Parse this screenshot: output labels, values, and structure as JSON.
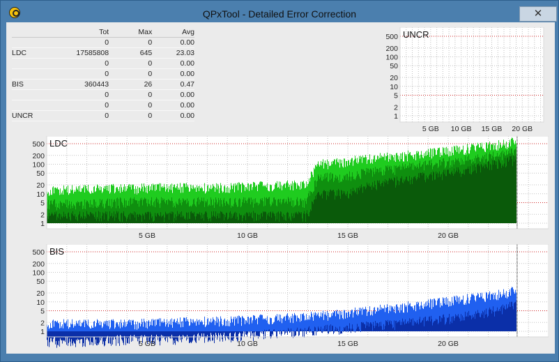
{
  "window": {
    "title": "QPxTool - Detailed Error Correction",
    "close_label": "✕"
  },
  "table": {
    "columns": [
      "",
      "Tot",
      "Max",
      "Avg"
    ],
    "rows": [
      [
        "",
        "0",
        "0",
        "0.00"
      ],
      [
        "LDC",
        "17585808",
        "645",
        "23.03"
      ],
      [
        "",
        "0",
        "0",
        "0.00"
      ],
      [
        "",
        "0",
        "0",
        "0.00"
      ],
      [
        "BIS",
        "360443",
        "26",
        "0.47"
      ],
      [
        "",
        "0",
        "0",
        "0.00"
      ],
      [
        "",
        "0",
        "0",
        "0.00"
      ],
      [
        "UNCR",
        "0",
        "0",
        "0.00"
      ]
    ]
  },
  "chart_data": [
    {
      "type": "area",
      "title": "UNCR",
      "scale": "log",
      "y_ticks": [
        1,
        2,
        5,
        10,
        20,
        50,
        100,
        200,
        500
      ],
      "x_tick_labels": [
        "5 GB",
        "10 GB",
        "15 GB",
        "20 GB"
      ],
      "x_ticks": [
        5,
        10,
        15,
        20
      ],
      "xlim": [
        0,
        23.5
      ],
      "grid": true,
      "threshold_lines": [
        5,
        500
      ],
      "series": [
        {
          "values": []
        }
      ],
      "colors": {
        "line": "#2a8c2a"
      }
    },
    {
      "type": "area",
      "title": "LDC",
      "scale": "log",
      "y_ticks": [
        1,
        2,
        5,
        10,
        20,
        50,
        100,
        200,
        500
      ],
      "x_tick_labels": [
        "5 GB",
        "10 GB",
        "15 GB",
        "20 GB"
      ],
      "x_ticks": [
        5,
        10,
        15,
        20
      ],
      "xlim": [
        0,
        25
      ],
      "grid": true,
      "threshold_lines": [
        5,
        500
      ],
      "data_end_gb": 23.4,
      "series": [
        {
          "x": [
            0,
            2,
            4,
            6,
            8,
            10,
            12,
            12.9,
            13.5,
            15,
            16,
            18,
            20,
            22,
            23.3
          ],
          "values": [
            14,
            16,
            17,
            18,
            18,
            20,
            22,
            23,
            110,
            140,
            170,
            230,
            320,
            470,
            645
          ]
        },
        {
          "x": [
            0,
            2,
            4,
            6,
            8,
            10,
            12,
            12.9,
            13.5,
            15,
            16,
            18,
            20,
            22,
            23.3
          ],
          "values": [
            5,
            5,
            6,
            6,
            6,
            6,
            6,
            6,
            38,
            45,
            60,
            90,
            130,
            200,
            300
          ]
        },
        {
          "x": [
            0,
            2,
            4,
            6,
            8,
            10,
            12,
            12.9,
            13.5,
            15,
            16,
            18,
            20,
            22,
            23.3
          ],
          "values": [
            2,
            2,
            2,
            2,
            2,
            2,
            2,
            2,
            10,
            12,
            20,
            35,
            55,
            100,
            160
          ]
        }
      ],
      "colors": {
        "peak": "#1fcc1f",
        "avg": "#0f8f0f",
        "low": "#0a5a0a"
      }
    },
    {
      "type": "area",
      "title": "BIS",
      "scale": "log",
      "y_ticks": [
        1,
        2,
        5,
        10,
        20,
        50,
        100,
        200,
        500
      ],
      "x_tick_labels": [
        "5 GB",
        "10 GB",
        "15 GB",
        "20 GB"
      ],
      "x_ticks": [
        5,
        10,
        15,
        20
      ],
      "xlim": [
        0,
        25
      ],
      "grid": true,
      "threshold_lines": [
        5,
        500
      ],
      "data_end_gb": 23.4,
      "series": [
        {
          "x": [
            0,
            2,
            4,
            6,
            8,
            10,
            12,
            14,
            16,
            18,
            20,
            22,
            23.3
          ],
          "values": [
            2,
            2,
            2,
            2.2,
            2.5,
            2.8,
            3.2,
            4,
            5.5,
            8,
            12,
            18,
            26
          ]
        },
        {
          "x": [
            0,
            2,
            4,
            6,
            8,
            10,
            12,
            14,
            16,
            18,
            20,
            22,
            23.3
          ],
          "values": [
            0.5,
            0.5,
            0.6,
            0.6,
            0.7,
            0.8,
            1,
            1.3,
            1.7,
            2.2,
            3,
            5,
            9
          ]
        }
      ],
      "colors": {
        "peak": "#2060f0",
        "avg": "#0b2fa8"
      }
    }
  ]
}
